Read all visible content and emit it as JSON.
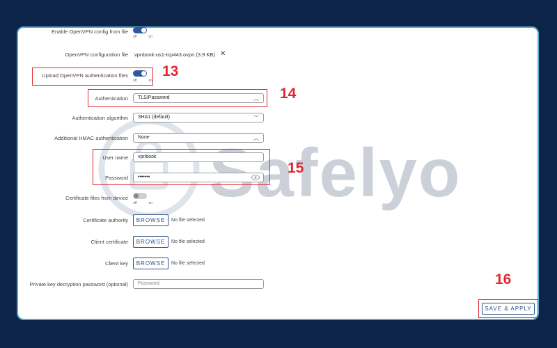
{
  "form": {
    "enable_config": {
      "label": "Enable OpenVPN config from file",
      "off": "off",
      "on": "on"
    },
    "config_file": {
      "label": "OpenVPN configuration file",
      "value": "vpnbook-us1-tcp443.ovpn (3.9 KB)"
    },
    "upload_auth": {
      "label": "Upload OpenVPN authentication files",
      "off": "off",
      "on": "on"
    },
    "authentication": {
      "label": "Authentication",
      "value": "TLS/Password"
    },
    "auth_algorithm": {
      "label": "Authentication algorithm",
      "value": "SHA1 (default)"
    },
    "hmac": {
      "label": "Additional HMAC authentication",
      "value": "None"
    },
    "username": {
      "label": "User name",
      "value": "vpnbook"
    },
    "password": {
      "label": "Password",
      "value": "•••••••"
    },
    "cert_from_device": {
      "label": "Certificate files from device",
      "off": "off",
      "on": "on"
    },
    "cert_authority": {
      "label": "Certificate authority",
      "browse": "BROWSE",
      "status": "No file selected"
    },
    "client_cert": {
      "label": "Client certificate",
      "browse": "BROWSE",
      "status": "No file selected"
    },
    "client_key": {
      "label": "Client key",
      "browse": "BROWSE",
      "status": "No file selected"
    },
    "key_password": {
      "label": "Private key decryption password (optional)",
      "placeholder": "Password"
    }
  },
  "save_apply": "SAVE & APPLY",
  "annotations": {
    "n13": "13",
    "n14": "14",
    "n15": "15",
    "n16": "16"
  },
  "watermark": "Safelyo",
  "colors": {
    "background": "#0b2447",
    "accent": "#2c4f86",
    "highlight": "#e3262d",
    "panel_border": "#5aa9d6"
  }
}
